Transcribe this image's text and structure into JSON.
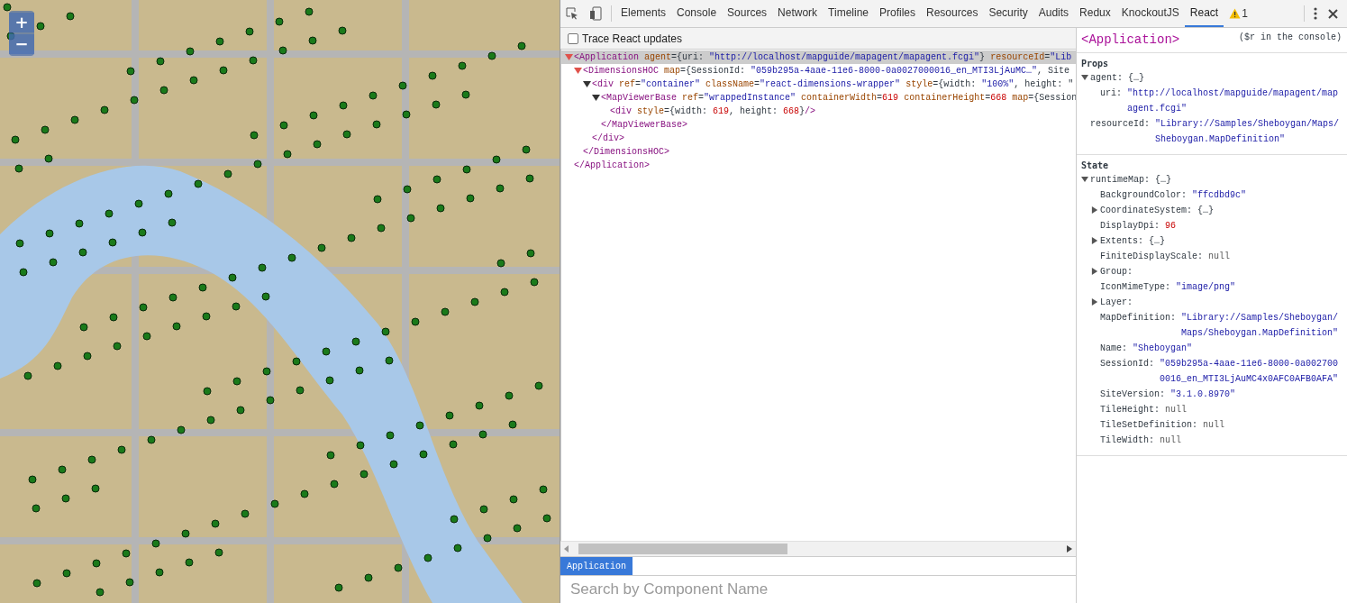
{
  "map": {
    "zoom_in": "+",
    "zoom_out": "−"
  },
  "devtools": {
    "tabs": [
      {
        "label": "Elements",
        "selected": false
      },
      {
        "label": "Console",
        "selected": false
      },
      {
        "label": "Sources",
        "selected": false
      },
      {
        "label": "Network",
        "selected": false
      },
      {
        "label": "Timeline",
        "selected": false
      },
      {
        "label": "Profiles",
        "selected": false
      },
      {
        "label": "Resources",
        "selected": false
      },
      {
        "label": "Security",
        "selected": false
      },
      {
        "label": "Audits",
        "selected": false
      },
      {
        "label": "Redux",
        "selected": false
      },
      {
        "label": "KnockoutJS",
        "selected": false
      },
      {
        "label": "React",
        "selected": true
      }
    ],
    "warning_count": "1",
    "trace_option": {
      "label": "Trace React updates",
      "checked": false
    },
    "tree": [
      {
        "expanded": true,
        "selected": true,
        "children": [
          {
            "kind": "tag",
            "text": "<Application"
          },
          {
            "kind": "attr",
            "text": " agent"
          },
          {
            "kind": "punct",
            "text": "={uri: "
          },
          {
            "kind": "string",
            "text": "\"http://localhost/mapguide/mapagent/mapagent.fcgi\""
          },
          {
            "kind": "punct",
            "text": "}"
          },
          {
            "kind": "attr",
            "text": " resourceId"
          },
          {
            "kind": "punct",
            "text": "="
          },
          {
            "kind": "string",
            "text": "\"Lib"
          }
        ],
        "nodes": [
          {
            "expanded": true,
            "selected": false,
            "children": [
              {
                "kind": "tag",
                "text": "<DimensionsHOC"
              },
              {
                "kind": "attr",
                "text": " map"
              },
              {
                "kind": "punct",
                "text": "={SessionId: "
              },
              {
                "kind": "string",
                "text": "\"059b295a-4aae-11e6-8000-0a0027000016_en_MTI3LjAuMC…\""
              },
              {
                "kind": "punct",
                "text": ", Site"
              }
            ],
            "nodes": [
              {
                "expanded": true,
                "selected": false,
                "children": [
                  {
                    "kind": "tag",
                    "text": "<div"
                  },
                  {
                    "kind": "attr",
                    "text": " ref"
                  },
                  {
                    "kind": "punct",
                    "text": "="
                  },
                  {
                    "kind": "string",
                    "text": "\"container\""
                  },
                  {
                    "kind": "attr",
                    "text": " className"
                  },
                  {
                    "kind": "punct",
                    "text": "="
                  },
                  {
                    "kind": "string",
                    "text": "\"react-dimensions-wrapper\""
                  },
                  {
                    "kind": "attr",
                    "text": " style"
                  },
                  {
                    "kind": "punct",
                    "text": "={width: "
                  },
                  {
                    "kind": "string",
                    "text": "\"100%\""
                  },
                  {
                    "kind": "punct",
                    "text": ", height: \""
                  }
                ],
                "nodes": [
                  {
                    "expanded": true,
                    "selected": false,
                    "children": [
                      {
                        "kind": "tag",
                        "text": "<MapViewerBase"
                      },
                      {
                        "kind": "attr",
                        "text": " ref"
                      },
                      {
                        "kind": "punct",
                        "text": "="
                      },
                      {
                        "kind": "string",
                        "text": "\"wrappedInstance\""
                      },
                      {
                        "kind": "attr",
                        "text": " containerWidth"
                      },
                      {
                        "kind": "punct",
                        "text": "="
                      },
                      {
                        "kind": "number",
                        "text": "619"
                      },
                      {
                        "kind": "attr",
                        "text": " containerHeight"
                      },
                      {
                        "kind": "punct",
                        "text": "="
                      },
                      {
                        "kind": "number",
                        "text": "668"
                      },
                      {
                        "kind": "attr",
                        "text": " map"
                      },
                      {
                        "kind": "punct",
                        "text": "={Session"
                      }
                    ],
                    "nodes": [
                      {
                        "children": [
                          {
                            "kind": "tag",
                            "text": "<div"
                          },
                          {
                            "kind": "attr",
                            "text": " style"
                          },
                          {
                            "kind": "punct",
                            "text": "={width: "
                          },
                          {
                            "kind": "number",
                            "text": "619"
                          },
                          {
                            "kind": "punct",
                            "text": ", height: "
                          },
                          {
                            "kind": "number",
                            "text": "668"
                          },
                          {
                            "kind": "punct",
                            "text": "}"
                          },
                          {
                            "kind": "tag",
                            "text": "/>"
                          }
                        ],
                        "selected": false
                      }
                    ],
                    "close": "</MapViewerBase>"
                  }
                ],
                "close": "</div>"
              }
            ],
            "close": "</DimensionsHOC>"
          }
        ],
        "close": "</Application>"
      }
    ],
    "breadcrumb": [
      {
        "label": "Application",
        "selected": true
      }
    ],
    "search": {
      "placeholder": "Search by Component Name"
    },
    "sidebar": {
      "component": "<Application>",
      "hint": "($r in the console)",
      "sections": [
        {
          "title": "Props",
          "items": [
            {
              "key": "agent:",
              "value": "{…}",
              "kind": "object",
              "expanded": true,
              "children": [
                {
                  "key": "uri:",
                  "value": "\"http://localhost/mapguide/mapagent/mapagent.fcgi\"",
                  "kind": "string"
                }
              ]
            },
            {
              "key": "resourceId:",
              "value": "\"Library://Samples/Sheboygan/Maps/Sheboygan.MapDefinition\"",
              "kind": "string"
            }
          ]
        },
        {
          "title": "State",
          "items": [
            {
              "key": "runtimeMap:",
              "value": "{…}",
              "kind": "object",
              "expanded": true,
              "children": [
                {
                  "key": "BackgroundColor:",
                  "value": "\"ffcdbd9c\"",
                  "kind": "string"
                },
                {
                  "key": "CoordinateSystem:",
                  "value": "{…}",
                  "kind": "object",
                  "expanded": false
                },
                {
                  "key": "DisplayDpi:",
                  "value": "96",
                  "kind": "number"
                },
                {
                  "key": "Extents:",
                  "value": "{…}",
                  "kind": "object",
                  "expanded": false
                },
                {
                  "key": "FiniteDisplayScale:",
                  "value": "null",
                  "kind": "null"
                },
                {
                  "key": "Group:",
                  "kind": "object",
                  "expanded": false
                },
                {
                  "key": "IconMimeType:",
                  "value": "\"image/png\"",
                  "kind": "string"
                },
                {
                  "key": "Layer:",
                  "kind": "object",
                  "expanded": false
                },
                {
                  "key": "MapDefinition:",
                  "value": "\"Library://Samples/Sheboygan/Maps/Sheboygan.MapDefinition\"",
                  "kind": "string"
                },
                {
                  "key": "Name:",
                  "value": "\"Sheboygan\"",
                  "kind": "string"
                },
                {
                  "key": "SessionId:",
                  "value": "\"059b295a-4aae-11e6-8000-0a0027000016_en_MTI3LjAuMC4x0AFC0AFB0AFA\"",
                  "kind": "string"
                },
                {
                  "key": "SiteVersion:",
                  "value": "\"3.1.0.8970\"",
                  "kind": "string"
                },
                {
                  "key": "TileHeight:",
                  "value": "null",
                  "kind": "null"
                },
                {
                  "key": "TileSetDefinition:",
                  "value": "null",
                  "kind": "null"
                },
                {
                  "key": "TileWidth:",
                  "value": "null",
                  "kind": "null"
                }
              ]
            }
          ]
        }
      ]
    }
  }
}
